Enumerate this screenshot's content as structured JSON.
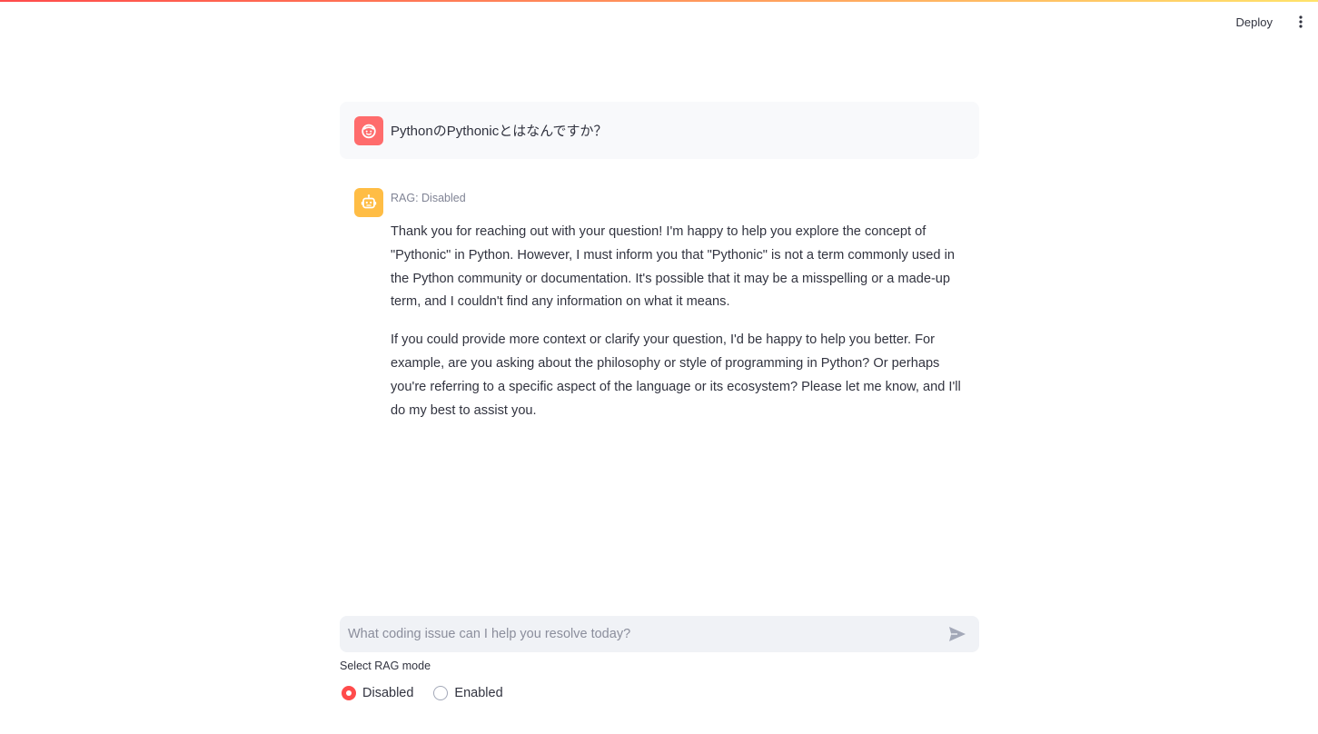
{
  "header": {
    "deploy_label": "Deploy",
    "menu_icon": "vertical-ellipsis-icon"
  },
  "colors": {
    "accent": "#ff4b4b",
    "user_avatar": "#ff6c6c",
    "assistant_avatar": "#ffbd45",
    "user_bubble_bg": "#f8f9fb",
    "input_bg": "#f0f2f6",
    "text": "#31333f",
    "muted_text": "#808495"
  },
  "chat": {
    "user_message": {
      "avatar_icon": "smiley-face-icon",
      "text": "PythonのPythonicとはなんですか？"
    },
    "assistant_message": {
      "avatar_icon": "robot-icon",
      "status": "RAG: Disabled",
      "paragraphs": [
        "Thank you for reaching out with your question! I'm happy to help you explore the concept of \"Pythonic\" in Python. However, I must inform you that \"Pythonic\" is not a term commonly used in the Python community or documentation. It's possible that it may be a misspelling or a made-up term, and I couldn't find any information on what it means.",
        "If you could provide more context or clarify your question, I'd be happy to help you better. For example, are you asking about the philosophy or style of programming in Python? Or perhaps you're referring to a specific aspect of the language or its ecosystem? Please let me know, and I'll do my best to assist you."
      ]
    }
  },
  "input": {
    "placeholder": "What coding issue can I help you resolve today?",
    "value": "",
    "send_icon": "send-arrow-icon"
  },
  "rag_mode": {
    "label": "Select RAG mode",
    "options": [
      {
        "label": "Disabled",
        "selected": true
      },
      {
        "label": "Enabled",
        "selected": false
      }
    ]
  }
}
